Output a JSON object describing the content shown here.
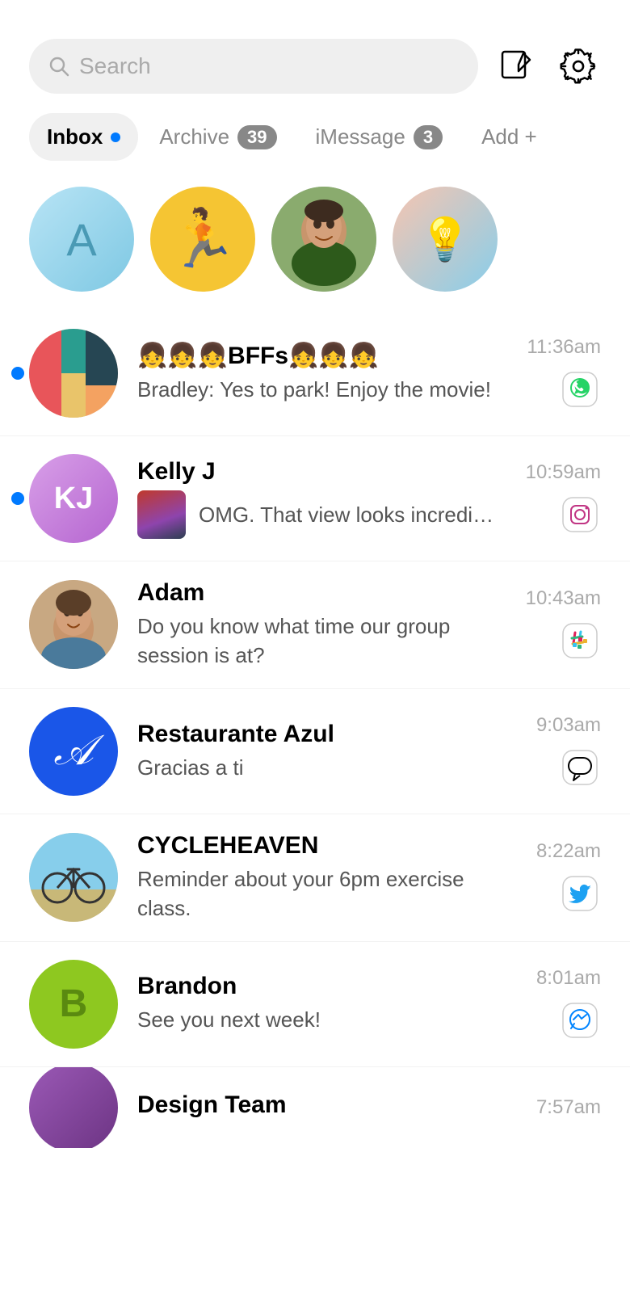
{
  "search": {
    "placeholder": "Search"
  },
  "header": {
    "compose_label": "Compose",
    "settings_label": "Settings"
  },
  "tabs": [
    {
      "id": "inbox",
      "label": "Inbox",
      "active": true,
      "badge": null,
      "dot": true
    },
    {
      "id": "archive",
      "label": "Archive",
      "active": false,
      "badge": "39",
      "dot": false
    },
    {
      "id": "imessage",
      "label": "iMessage",
      "active": false,
      "badge": "3",
      "dot": false
    },
    {
      "id": "add",
      "label": "Add +",
      "active": false,
      "badge": null,
      "dot": false
    }
  ],
  "stories": [
    {
      "id": "story-a",
      "type": "letter",
      "letter": "A",
      "color": "#a8d8f0"
    },
    {
      "id": "story-emoji",
      "type": "emoji",
      "emoji": "🏃",
      "bg": "#f5c842"
    },
    {
      "id": "story-photo1",
      "type": "photo",
      "bg": "#6b8f5e"
    },
    {
      "id": "story-photo2",
      "type": "gradient",
      "bg": "linear-gradient(135deg,#f5a7a0,#87ceeb)"
    }
  ],
  "messages": [
    {
      "id": "bffs",
      "name": "👧👧👧BFFs👧👧👧",
      "preview": "Bradley: Yes to park! Enjoy the movie!",
      "time": "11:36am",
      "platform": "whatsapp",
      "unread": true,
      "avatar_type": "image",
      "avatar_bg": "#e8c9a0"
    },
    {
      "id": "kelly-j",
      "name": "Kelly J",
      "preview": "OMG. That view looks incredible",
      "time": "10:59am",
      "platform": "instagram",
      "unread": true,
      "avatar_type": "initials",
      "avatar_initials": "KJ",
      "avatar_bg_from": "#d89fe8",
      "avatar_bg_to": "#b565d0"
    },
    {
      "id": "adam",
      "name": "Adam",
      "preview": "Do you know what time our group session is at?",
      "time": "10:43am",
      "platform": "slack",
      "unread": false,
      "avatar_type": "photo",
      "avatar_bg": "#c8a882"
    },
    {
      "id": "restaurante-azul",
      "name": "Restaurante Azul",
      "preview": "Gracias a ti",
      "time": "9:03am",
      "platform": "imessage",
      "unread": false,
      "avatar_type": "letter_script",
      "avatar_initials": "A",
      "avatar_bg": "#1a56e8"
    },
    {
      "id": "cycleheaven",
      "name": "CYCLEHEAVEN",
      "preview": "Reminder about your 6pm exercise class.",
      "time": "8:22am",
      "platform": "twitter",
      "unread": false,
      "avatar_type": "photo",
      "avatar_bg": "#8aab6e"
    },
    {
      "id": "brandon",
      "name": "Brandon",
      "preview": "See you next week!",
      "time": "8:01am",
      "platform": "messenger",
      "unread": false,
      "avatar_type": "letter",
      "avatar_initials": "B",
      "avatar_bg": "#8ec820"
    },
    {
      "id": "design-team",
      "name": "Design Team",
      "preview": "",
      "time": "7:57am",
      "platform": "",
      "unread": false,
      "avatar_type": "gradient",
      "avatar_bg": "#9b59b6"
    }
  ]
}
